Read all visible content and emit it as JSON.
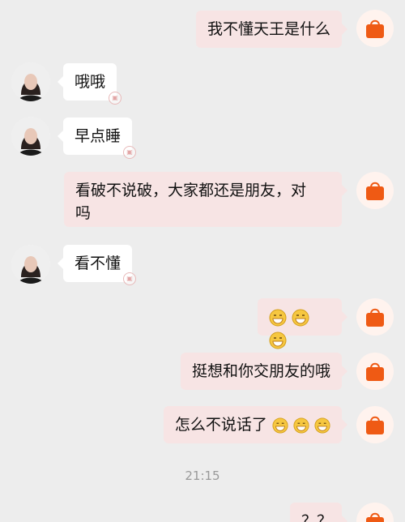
{
  "messages": [
    {
      "side": "right",
      "text": "我不懂天王是什么"
    },
    {
      "side": "left",
      "text": "哦哦"
    },
    {
      "side": "left",
      "text": "早点睡"
    },
    {
      "side": "right",
      "text_line1": "看破不说破，大家都还是朋友，对",
      "text_line2": "吗"
    },
    {
      "side": "left",
      "text": "看不懂"
    },
    {
      "side": "right",
      "text": "",
      "emoji_icon": "grinning-face-icon"
    },
    {
      "side": "right",
      "text": "挺想和你交朋友的哦"
    },
    {
      "side": "right",
      "text": "怎么不说话了",
      "emoji_icon": "grinning-face-icon"
    },
    {
      "side": "right",
      "text": "？？"
    }
  ],
  "timestamp": "21:15",
  "icons": {
    "right_avatar": "orange-handbag-icon",
    "left_avatar": "woman-portrait-avatar",
    "watermark": "stamp-watermark-icon"
  },
  "colors": {
    "background": "#ededed",
    "right_bubble": "#f7e4e4",
    "left_bubble": "#ffffff",
    "bag_orange": "#ef5a14"
  }
}
